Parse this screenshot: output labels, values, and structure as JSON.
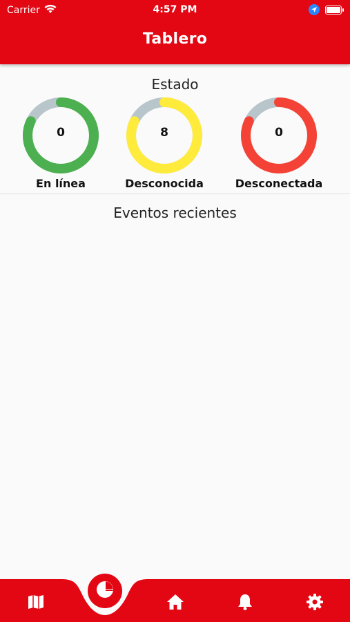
{
  "status_bar": {
    "carrier": "Carrier",
    "time": "4:57 PM",
    "wifi_icon": "wifi-icon",
    "location_icon": "location-arrow-icon",
    "battery_icon": "battery-icon"
  },
  "header": {
    "title": "Tablero"
  },
  "estado": {
    "title": "Estado",
    "gauges": [
      {
        "value": "0",
        "label": "En línea",
        "color": "#4caf50",
        "fill": 0.82
      },
      {
        "value": "8",
        "label": "Desconocida",
        "color": "#ffeb3b",
        "fill": 0.82
      },
      {
        "value": "0",
        "label": "Desconectada",
        "color": "#f44336",
        "fill": 0.82
      }
    ]
  },
  "eventos": {
    "title": "Eventos recientes"
  },
  "bottom_nav": {
    "items": [
      {
        "icon": "map-icon"
      },
      {
        "icon": "pie-chart-icon",
        "active": true
      },
      {
        "icon": "home-icon"
      },
      {
        "icon": "bell-icon"
      },
      {
        "icon": "gear-icon"
      }
    ],
    "color": "#e30613"
  }
}
